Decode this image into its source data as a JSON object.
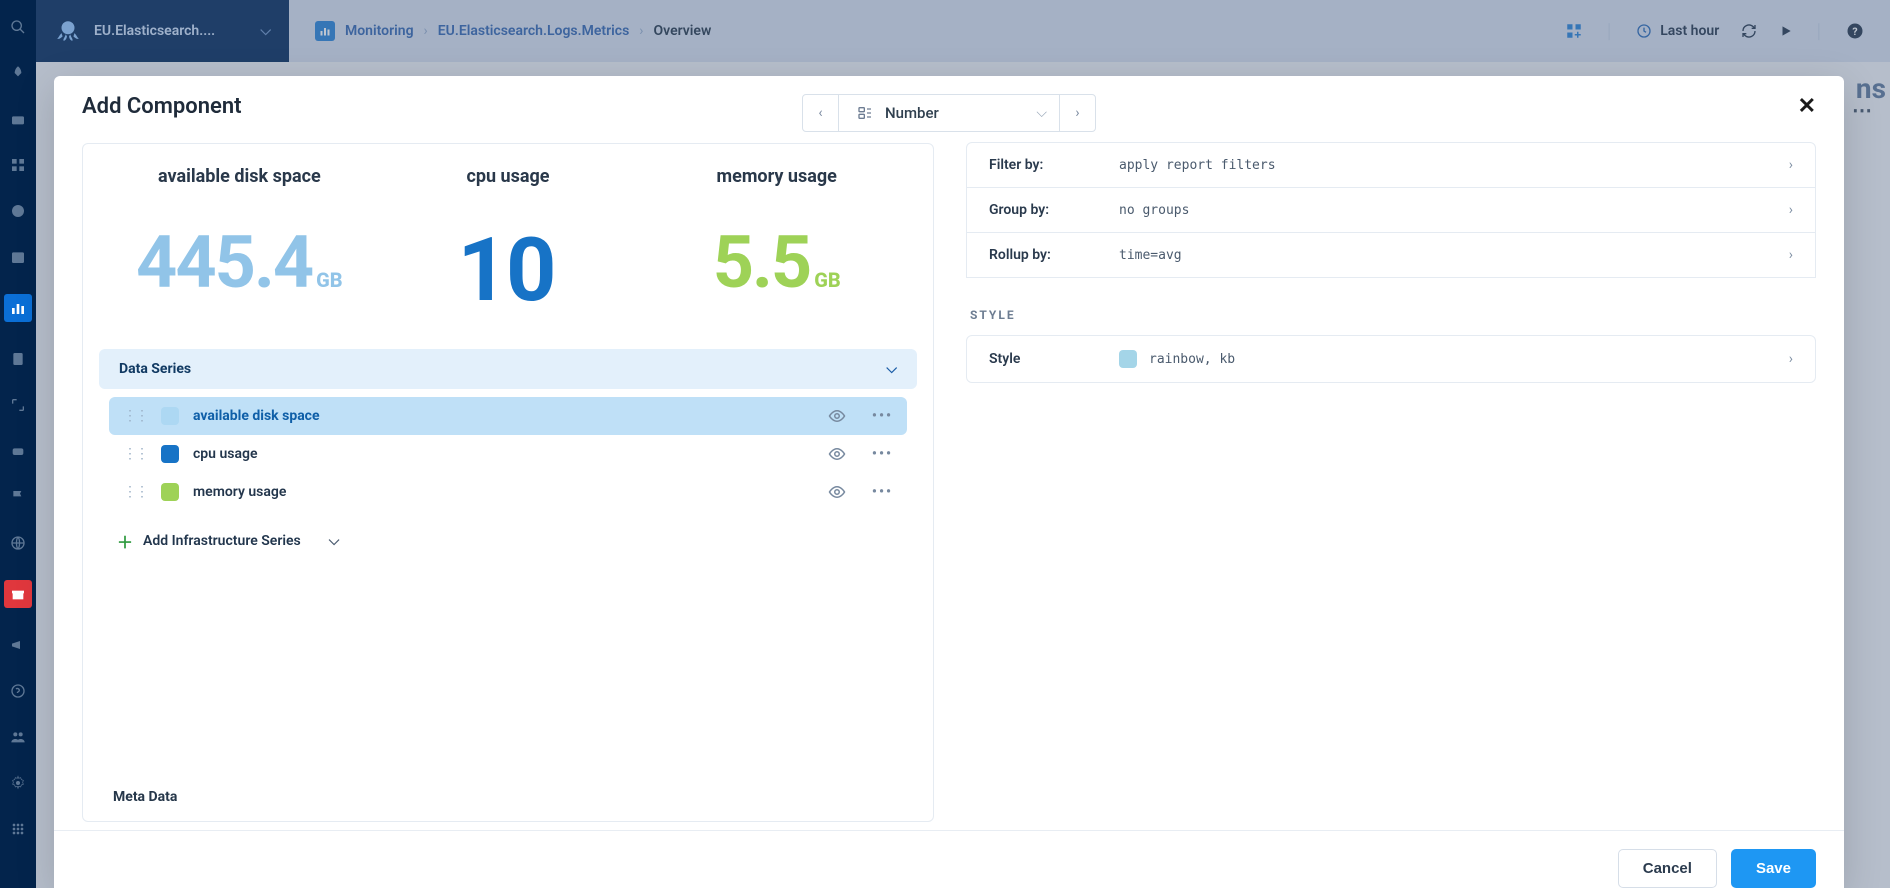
{
  "project_name": "EU.Elasticsearch....",
  "breadcrumb": {
    "root": "Monitoring",
    "mid": "EU.Elasticsearch.Logs.Metrics",
    "leaf": "Overview"
  },
  "time_range": "Last hour",
  "modal": {
    "title": "Add Component",
    "component_type": "Number",
    "cancel": "Cancel",
    "save": "Save"
  },
  "preview": [
    {
      "title": "available disk space",
      "value": "445.4",
      "unit": "GB",
      "color": "#91c4e8"
    },
    {
      "title": "cpu usage",
      "value": "10",
      "unit": "",
      "color": "#1773c6"
    },
    {
      "title": "memory usage",
      "value": "5.5",
      "unit": "GB",
      "color": "#9ed257"
    }
  ],
  "data_series_header": "Data Series",
  "series": [
    {
      "label": "available disk space",
      "color": "#add8f3",
      "selected": true
    },
    {
      "label": "cpu usage",
      "color": "#1773c6",
      "selected": false
    },
    {
      "label": "memory usage",
      "color": "#9ed257",
      "selected": false
    }
  ],
  "add_series_label": "Add Infrastructure Series",
  "meta_data_label": "Meta Data",
  "config": {
    "filter_by": {
      "label": "Filter by:",
      "value": "apply report filters"
    },
    "group_by": {
      "label": "Group by:",
      "value": "no groups"
    },
    "rollup_by": {
      "label": "Rollup by:",
      "value": "time=avg"
    }
  },
  "style_section": "STYLE",
  "style_row": {
    "label": "Style",
    "value": "rainbow, kb"
  },
  "bg_ghost": "ns"
}
